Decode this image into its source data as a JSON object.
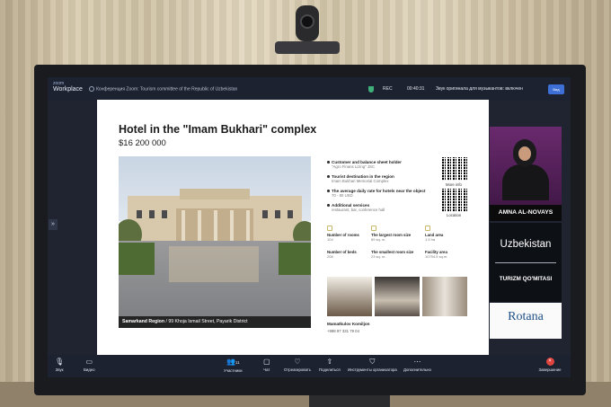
{
  "zoom": {
    "brand_top": "zoom",
    "brand": "Workplace",
    "meeting_title": "Конференция Zoom: Tourism committee of the Republic of Uzbekistan",
    "rec_label": "REC",
    "timer": "00:40:31",
    "audio_notice": "Звук оригинала для музыкантов: включен",
    "view_label": "Вид"
  },
  "slide": {
    "title": "Hotel in the \"Imam Bukhari\" complex",
    "price": "$16 200 000",
    "caption_region": "Samarkand Region",
    "caption_address": " / 99 Khoja Ismail Street, Payarik District",
    "info": [
      {
        "label": "Customer and balance sheet holder",
        "value": "\"Agro Finans Lizing\" JSC"
      },
      {
        "label": "Tourist destination in the region",
        "value": "Imam Bukhari Memorial Complex"
      },
      {
        "label": "The average daily rate for hotels near the object",
        "value": "70 - 80 USD"
      },
      {
        "label": "Additional services",
        "value": "restaurant, bar, conference hall"
      }
    ],
    "qr_labels": [
      "More info",
      "Location"
    ],
    "stats": [
      {
        "label": "Number of rooms",
        "value": "104"
      },
      {
        "label": "The largest room size",
        "value": "69 sq. m."
      },
      {
        "label": "Land area",
        "value": "1.5 ha"
      },
      {
        "label": "Number of beds",
        "value": "208"
      },
      {
        "label": "The smallest room size",
        "value": "23 sq. m."
      },
      {
        "label": "Facility area",
        "value": "10794.5 sq.m."
      }
    ],
    "contact_name": "Mamatkulov Komiljon",
    "contact_phone": "+998 97 331 79 04"
  },
  "gallery": {
    "speaker_name": "AMNA AL-NOVAYS",
    "banner_title": "Uzbekistan",
    "banner_subtitle": "TURIZM QO'MITASI",
    "sponsor": "Rotana"
  },
  "toolbar": {
    "audio": "Звук",
    "video": "Видео",
    "participants": "Участники",
    "participants_count": "11",
    "chat": "Чат",
    "react": "Отреагировать",
    "share": "Поделиться",
    "host_tools": "Инструменты организатора",
    "more": "Дополнительно",
    "leave": "Завершение"
  }
}
